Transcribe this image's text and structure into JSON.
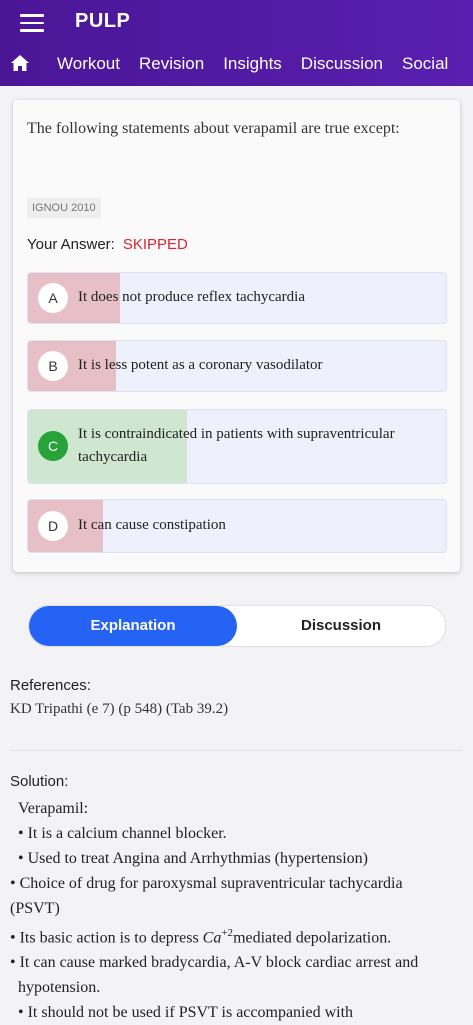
{
  "app": {
    "title": "PULP"
  },
  "nav": {
    "tabs": [
      "Workout",
      "Revision",
      "Insights",
      "Discussion",
      "Social"
    ]
  },
  "question": {
    "text": "The following statements about verapamil are true except:",
    "tag": "IGNOU 2010",
    "answer_label": "Your Answer:",
    "answer_value": "SKIPPED",
    "options": [
      {
        "letter": "A",
        "text": "It does not produce reflex tachycardia",
        "bar_fraction": 0.22,
        "status": "wrong"
      },
      {
        "letter": "B",
        "text": "It is less potent as a coronary vasodilator",
        "bar_fraction": 0.21,
        "status": "wrong"
      },
      {
        "letter": "C",
        "text": "It is contraindicated in patients with supraventricular tachycardia",
        "bar_fraction": 0.38,
        "status": "correct"
      },
      {
        "letter": "D",
        "text": "It can cause constipation",
        "bar_fraction": 0.18,
        "status": "wrong"
      }
    ]
  },
  "toggle": {
    "explanation": "Explanation",
    "discussion": "Discussion"
  },
  "references": {
    "title": "References:",
    "text": "KD Tripathi (e 7) (p 548) (Tab 39.2)"
  },
  "solution": {
    "title": "Solution:",
    "heading": "Verapamil:",
    "lines": [
      "•  It is a calcium channel blocker.",
      "•  Used to treat Angina and Arrhythmias (hypertension)",
      "• Choice of drug for paroxysmal supraventricular tachycardia (PSVT)",
      "•  It can cause marked bradycardia, A-V block cardiac arrest and hypotension.",
      "•  It should not be used if PSVT is accompanied with"
    ],
    "depress_line": {
      "prefix": "• Its basic action is to depress ",
      "ion": "Ca",
      "charge": "+2",
      "suffix": "mediated depolarization."
    }
  },
  "colors": {
    "appbar": "#4a1696",
    "primary": "#2563f5",
    "wrong": "#e6c0c6",
    "correct": "#27a33a",
    "skipped": "#d9262f"
  }
}
